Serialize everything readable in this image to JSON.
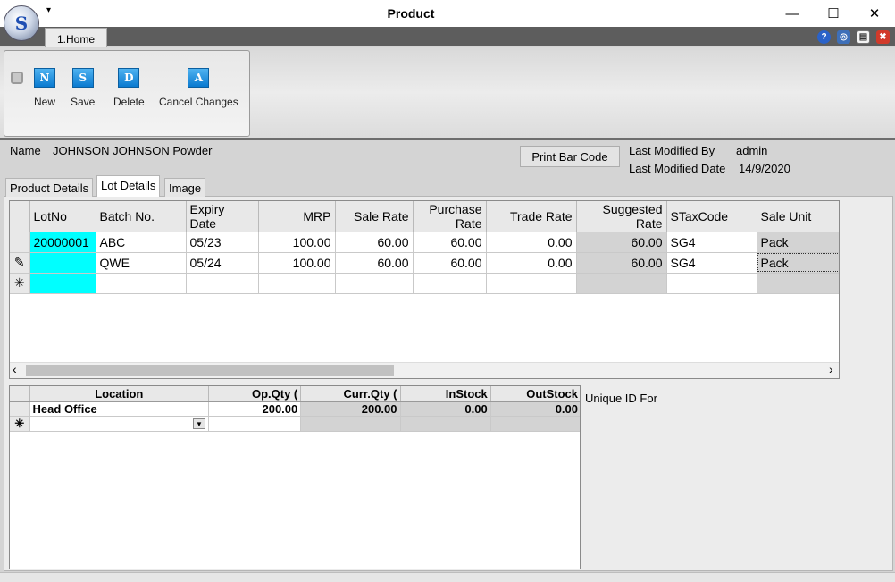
{
  "window": {
    "title": "Product",
    "minimize": "—",
    "maximize": "☐",
    "close": "✕",
    "logo_letter": "S",
    "qat_arrow": "▾"
  },
  "ribbon": {
    "tab": "1.Home",
    "help_icons": [
      "?",
      "◎",
      "▤",
      "✖"
    ],
    "buttons": [
      {
        "label": "New",
        "glyph": "N"
      },
      {
        "label": "Save",
        "glyph": "S"
      },
      {
        "label": "Delete",
        "glyph": "D"
      },
      {
        "label": "Cancel Changes",
        "glyph": "A"
      }
    ]
  },
  "header": {
    "name_label": "Name",
    "name_value": "JOHNSON JOHNSON Powder",
    "print_button": "Print Bar Code",
    "modified_by_label": "Last Modified By",
    "modified_by_value": "admin",
    "modified_date_label": "Last Modified Date",
    "modified_date_value": "14/9/2020"
  },
  "tabs": [
    "Product Details",
    "Lot Details",
    "Image"
  ],
  "lot_grid": {
    "columns": [
      "LotNo",
      "Batch No.",
      "Expiry Date",
      "MRP",
      "Sale Rate",
      "Purchase Rate",
      "Trade Rate",
      "Suggested Rate",
      "STaxCode",
      "Sale Unit"
    ],
    "rows": [
      {
        "indicator": "",
        "cells": [
          "20000001",
          "ABC",
          "05/23",
          "100.00",
          "60.00",
          "60.00",
          "0.00",
          "60.00",
          "SG4",
          "Pack"
        ]
      },
      {
        "indicator": "✎",
        "cells": [
          "",
          "QWE",
          "05/24",
          "100.00",
          "60.00",
          "60.00",
          "0.00",
          "60.00",
          "SG4",
          "Pack"
        ]
      }
    ],
    "new_row_indicator": "✳",
    "scroll_left": "‹",
    "scroll_right": "›"
  },
  "location_grid": {
    "columns": [
      "Location",
      "Op.Qty (",
      "Curr.Qty (",
      "InStock",
      "OutStock"
    ],
    "rows": [
      {
        "cells": [
          "Head Office",
          "200.00",
          "200.00",
          "0.00",
          "0.00"
        ]
      }
    ],
    "new_row_indicator": "✳",
    "dropdown": "▼"
  },
  "unique_id_label": "Unique ID For"
}
